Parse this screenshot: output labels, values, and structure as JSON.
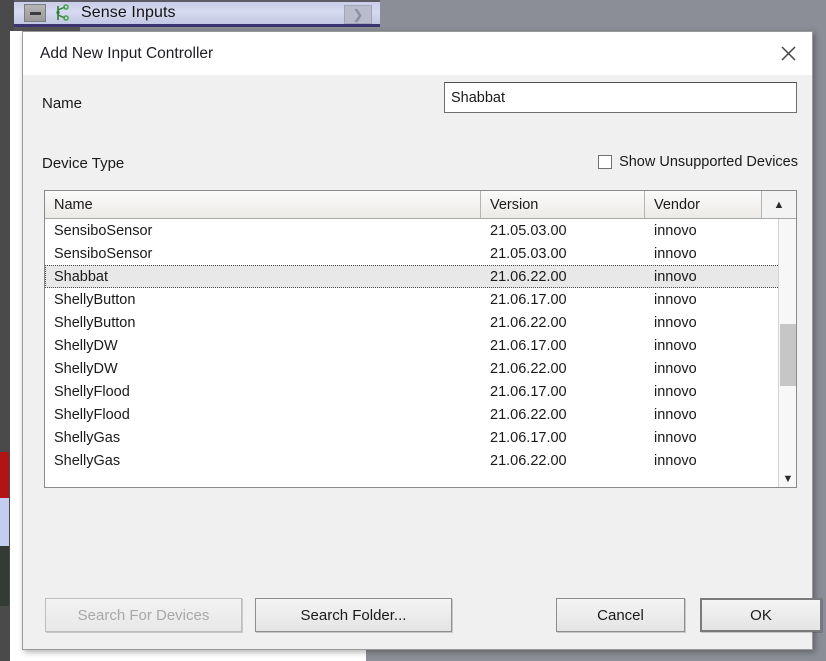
{
  "background": {
    "window_title": "Sense Inputs",
    "collapse_icon": "minus-icon",
    "app_icon": "node-graph-icon",
    "expand_icon": "chevron-right-icon"
  },
  "dialog": {
    "title": "Add New Input Controller",
    "close_icon": "close-icon",
    "name_field": {
      "label": "Name",
      "value": "Shabbat",
      "placeholder": ""
    },
    "device_type": {
      "label": "Device Type",
      "show_unsupported": {
        "label": "Show Unsupported Devices",
        "checked": false
      }
    },
    "device_list": {
      "columns": [
        "Name",
        "Version",
        "Vendor"
      ],
      "scroll_up_icon": "chevron-up-icon",
      "scroll_down_icon": "chevron-down-icon",
      "selected_index": 2,
      "rows": [
        {
          "name": "SensiboSensor",
          "version": "21.05.03.00",
          "vendor": "innovo"
        },
        {
          "name": "SensiboSensor",
          "version": "21.05.03.00",
          "vendor": "innovo"
        },
        {
          "name": "Shabbat",
          "version": "21.06.22.00",
          "vendor": "innovo"
        },
        {
          "name": "ShellyButton",
          "version": "21.06.17.00",
          "vendor": "innovo"
        },
        {
          "name": "ShellyButton",
          "version": "21.06.22.00",
          "vendor": "innovo"
        },
        {
          "name": "ShellyDW",
          "version": "21.06.17.00",
          "vendor": "innovo"
        },
        {
          "name": "ShellyDW",
          "version": "21.06.22.00",
          "vendor": "innovo"
        },
        {
          "name": "ShellyFlood",
          "version": "21.06.17.00",
          "vendor": "innovo"
        },
        {
          "name": "ShellyFlood",
          "version": "21.06.22.00",
          "vendor": "innovo"
        },
        {
          "name": "ShellyGas",
          "version": "21.06.17.00",
          "vendor": "innovo"
        },
        {
          "name": "ShellyGas",
          "version": "21.06.22.00",
          "vendor": "innovo"
        }
      ]
    },
    "buttons": {
      "search_for_devices": "Search For Devices",
      "search_for_devices_enabled": false,
      "search_folder": "Search Folder...",
      "cancel": "Cancel",
      "ok": "OK"
    }
  },
  "colors": {
    "titlebar_accent": "#3b3470",
    "dialog_bg": "#f0f0f0",
    "selected_row": "#e8e8e8",
    "backdrop": "#8b8e96"
  }
}
